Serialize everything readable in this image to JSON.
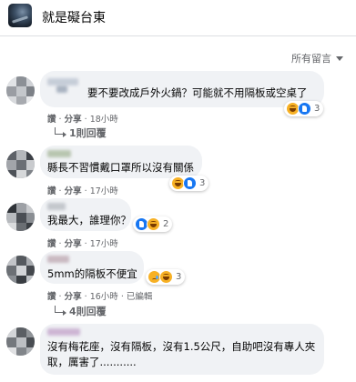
{
  "page": {
    "name": "就是礙台東"
  },
  "sort": {
    "label": "所有留言"
  },
  "comments": [
    {
      "text": "要不要改成戶外火鍋？可能就不用隔板或空桌了",
      "reaction_count": "3",
      "reactions": [
        "haha-icon",
        "like-icon"
      ],
      "like": "讚",
      "share": "分享",
      "time": "18小時",
      "replies": "1則回覆"
    },
    {
      "text": "縣長不習慣戴口罩所以沒有關係",
      "reaction_count": "3",
      "reactions": [
        "haha-icon",
        "like-icon"
      ],
      "like": "讚",
      "share": "分享",
      "time": "17小時"
    },
    {
      "text": "我最大，誰理你？",
      "reaction_count": "2",
      "reactions": [
        "like-icon",
        "haha-icon"
      ],
      "like": "讚",
      "share": "分享",
      "time": "17小時"
    },
    {
      "text": "5mm的隔板不便宜",
      "reaction_count": "3",
      "reactions": [
        "sad-icon",
        "haha-icon"
      ],
      "like": "讚",
      "share": "分享",
      "time": "16小時",
      "edited": "已編輯",
      "replies": "4則回覆"
    },
    {
      "text_line1": "沒有梅花座，沒有隔板，沒有1.5公尺，自助吧沒有專人夾",
      "text_line2": "取，厲害了..........."
    }
  ],
  "separator": "·"
}
